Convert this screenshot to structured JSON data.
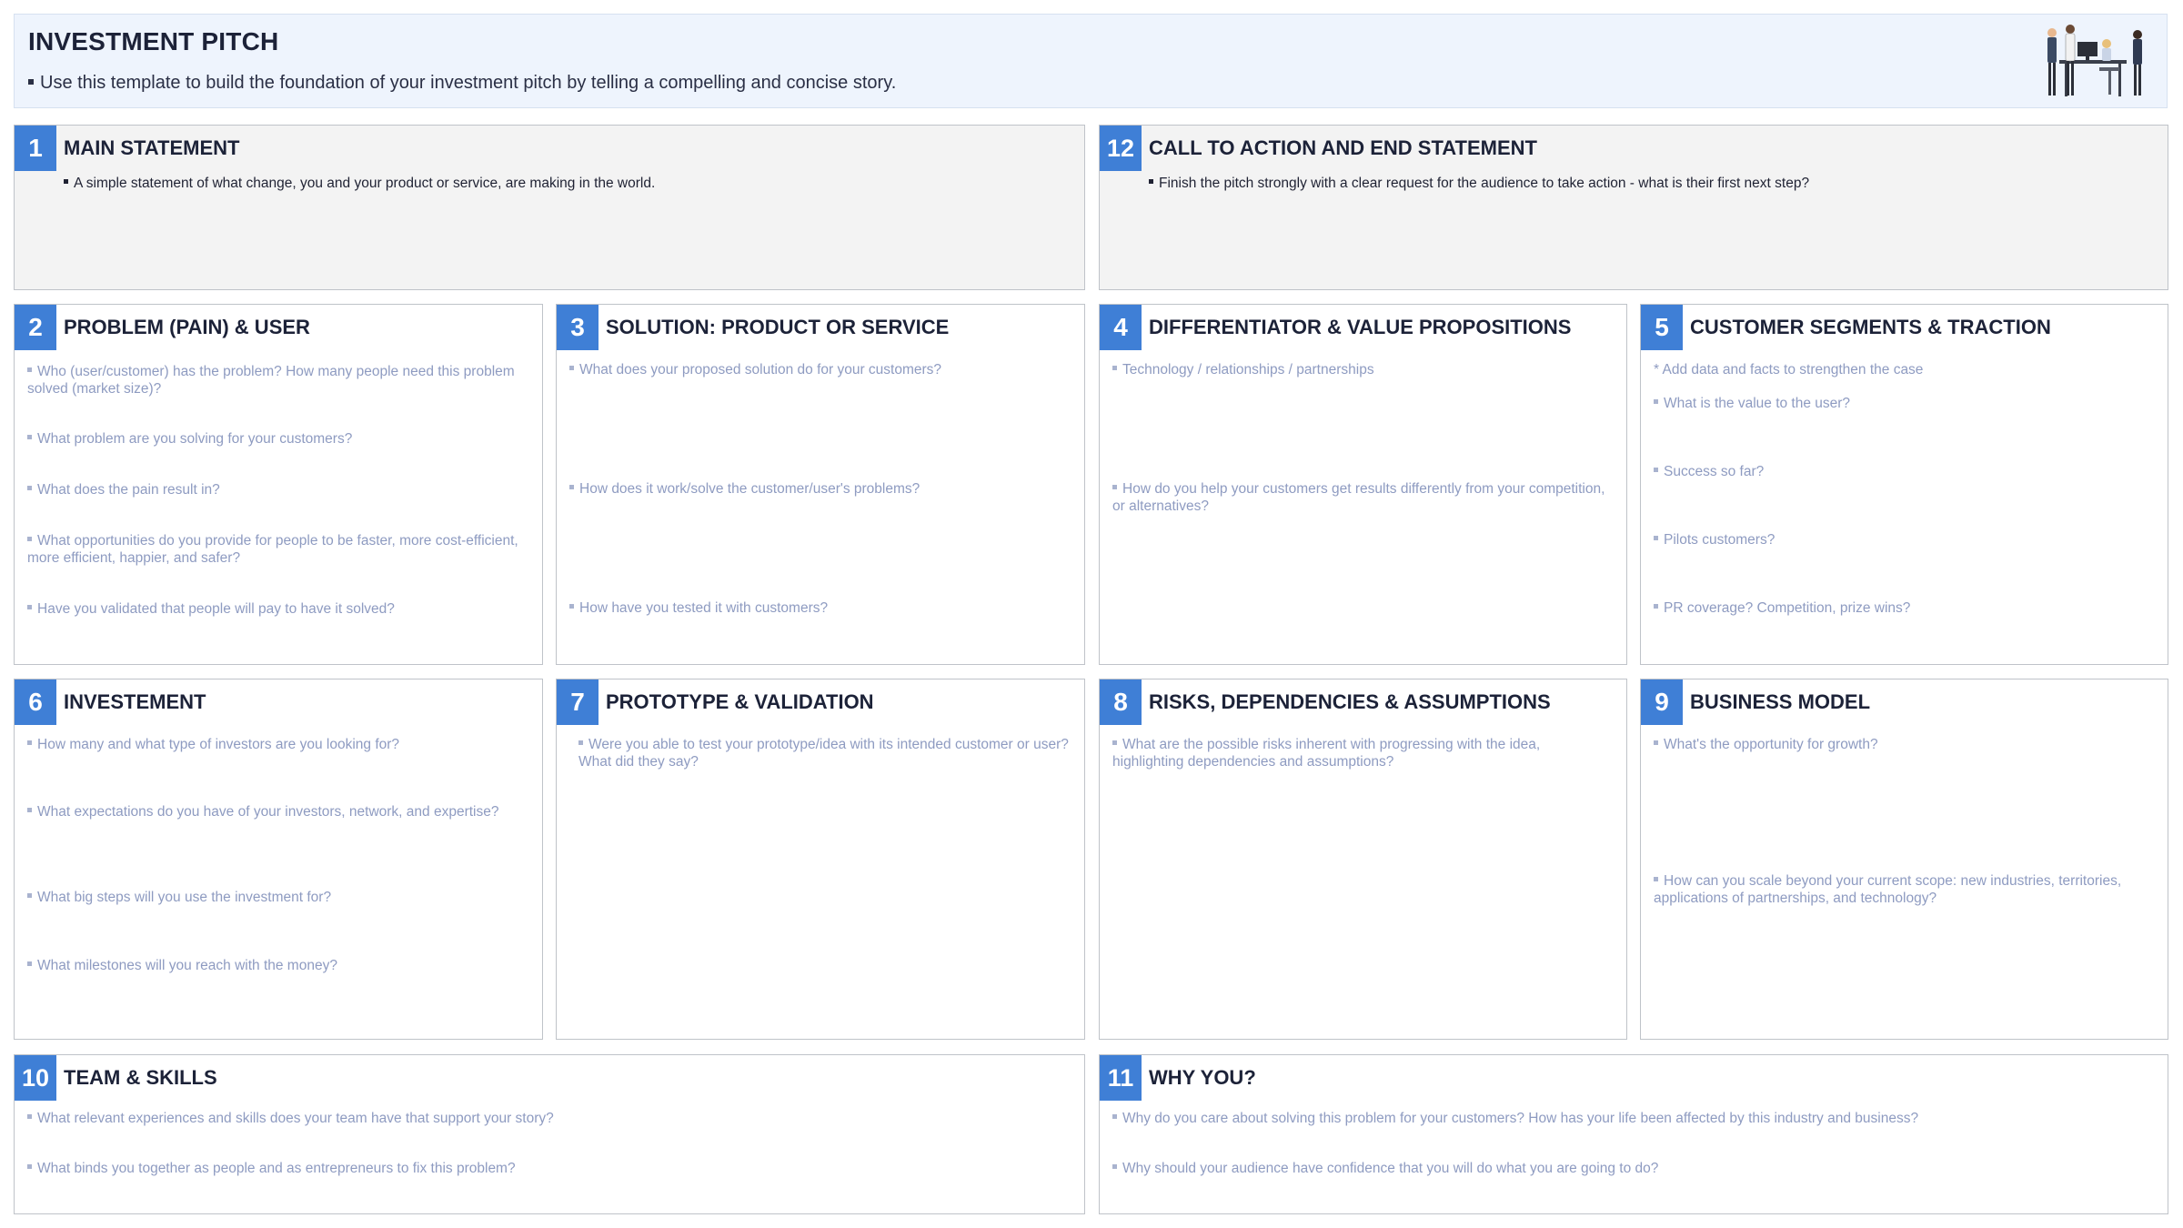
{
  "header": {
    "title": "INVESTMENT PITCH",
    "subtitle": "Use this template to build the foundation of your investment pitch by telling a compelling and concise story.",
    "illustration_icon": "team-meeting-illustration"
  },
  "colors": {
    "accent": "#3f7fd6",
    "header_bg": "#eef4fd",
    "prompt_text": "#8e9bc1",
    "grey_card": "#f3f3f3"
  },
  "cards": {
    "c1": {
      "number": "1",
      "title": "MAIN STATEMENT",
      "prompts": [
        "A simple statement of what change, you and your product or service, are making in the world."
      ]
    },
    "c12": {
      "number": "12",
      "title": "CALL TO ACTION AND END STATEMENT",
      "prompts": [
        "Finish the pitch strongly with a clear request for the audience to take action - what is their first next step?"
      ]
    },
    "c2": {
      "number": "2",
      "title": "PROBLEM (PAIN) & USER",
      "prompts": [
        "Who (user/customer) has the problem? How many people need this problem solved (market size)?",
        "What problem are you solving for your customers?",
        "What does the pain result in?",
        "What opportunities do you provide for people to be faster, more cost-efficient, more efficient, happier, and safer?",
        "Have you validated that people will pay to have it solved?"
      ]
    },
    "c3": {
      "number": "3",
      "title": "SOLUTION: PRODUCT OR SERVICE",
      "prompts": [
        "What does your proposed solution do for your customers?",
        "How does it work/solve the customer/user's problems?",
        "How have you tested it with customers?"
      ]
    },
    "c4": {
      "number": "4",
      "title": "DIFFERENTIATOR & VALUE PROPOSITIONS",
      "prompts": [
        "Technology / relationships / partnerships",
        "How do you help your customers get results differently from your competition, or alternatives?"
      ]
    },
    "c5": {
      "number": "5",
      "title": "CUSTOMER SEGMENTS & TRACTION",
      "note": "* Add data and facts to strengthen the case",
      "prompts": [
        "What is the value to the user?",
        "Success so far?",
        "Pilots customers?",
        "PR coverage? Competition, prize wins?"
      ]
    },
    "c6": {
      "number": "6",
      "title": "INVESTEMENT",
      "prompts": [
        "How many and what type of investors are you looking for?",
        "What expectations do you have of your investors, network, and expertise?",
        "What big steps will you use the investment for?",
        "What milestones will you reach with the money?"
      ]
    },
    "c7": {
      "number": "7",
      "title": "PROTOTYPE & VALIDATION",
      "prompts": [
        "Were you able to test your prototype/idea with its intended customer or user? What did they say?"
      ]
    },
    "c8": {
      "number": "8",
      "title": "RISKS, DEPENDENCIES & ASSUMPTIONS",
      "prompts": [
        "What are the possible risks inherent with progressing with the idea, highlighting dependencies and assumptions?"
      ]
    },
    "c9": {
      "number": "9",
      "title": "BUSINESS MODEL",
      "prompts": [
        "What's the opportunity for growth?",
        "How can you scale beyond your current scope: new industries, territories, applications of partnerships, and technology?"
      ]
    },
    "c10": {
      "number": "10",
      "title": "TEAM & SKILLS",
      "prompts": [
        "What relevant experiences and skills does your team have that support your story?",
        "What binds you together as people and as entrepreneurs to fix this problem?"
      ]
    },
    "c11": {
      "number": "11",
      "title": "WHY YOU?",
      "prompts": [
        "Why do you care about solving this problem for your customers? How has your life been affected by this industry and business?",
        "Why should your audience have confidence that you will do what you are going to do?"
      ]
    }
  }
}
